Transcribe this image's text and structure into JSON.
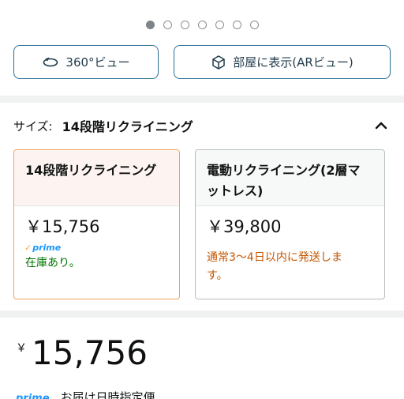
{
  "carousel": {
    "dot_count": 7,
    "active_index": 0
  },
  "view_buttons": {
    "view360": {
      "label": "360°ビュー",
      "icon": "rotate-360-icon"
    },
    "ar": {
      "label": "部屋に表示(ARビュー)",
      "icon": "ar-cube-icon"
    }
  },
  "size_selector": {
    "label": "サイズ:",
    "selected": "14段階リクライニング",
    "expanded_icon": "chevron-up-icon"
  },
  "options": [
    {
      "title": "14段階リクライニング",
      "price": "￥15,756",
      "prime": "prime",
      "status": "在庫あり。",
      "selected": true
    },
    {
      "title": "電動リクライニング(2層マットレス)",
      "title_line1": "電動リクライニング(2層マ",
      "title_line2": "ットレス)",
      "price": "￥39,800",
      "ship_line1": "通常3～4日以内に発送しま",
      "ship_line2": "す。",
      "selected": false
    }
  ],
  "price_block": {
    "currency": "￥",
    "amount": "15,756"
  },
  "delivery": {
    "prime": "prime",
    "text": "お届け日時指定便"
  },
  "colors": {
    "accent_border": "#e8a660",
    "button_border": "#2b6f96",
    "in_stock": "#007600",
    "shipping": "#c45500",
    "prime_blue": "#1a98ff"
  }
}
